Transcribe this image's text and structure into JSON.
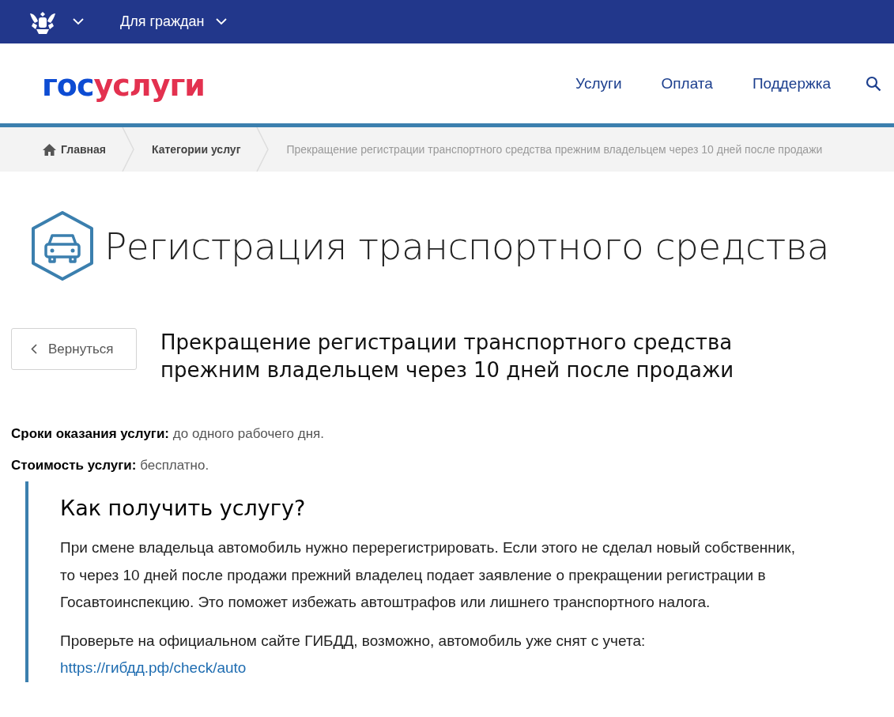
{
  "top_bar": {
    "audience_menu": "Для граждан"
  },
  "header": {
    "logo": [
      {
        "text": "гос",
        "color": "#0d4cd3"
      },
      {
        "text": "услуги",
        "color": "#e3314f"
      }
    ],
    "nav": [
      "Услуги",
      "Оплата",
      "Поддержка"
    ]
  },
  "breadcrumbs": [
    {
      "label": "Главная",
      "kind": "home"
    },
    {
      "label": "Категории услуг",
      "kind": "link"
    },
    {
      "label": "Прекращение регистрации транспортного средства прежним владельцем через 10 дней после продажи",
      "kind": "current"
    }
  ],
  "category_title": "Регистрация транспортного средства",
  "back_button": "Вернуться",
  "service_title": "Прекращение регистрации транспортного средства прежним владельцем через 10 дней после продажи",
  "facts": [
    {
      "label": "Сроки оказания услуги:",
      "value": "до одного рабочего дня."
    },
    {
      "label": "Стоимость услуги:",
      "value": "бесплатно."
    }
  ],
  "how_to": {
    "heading": "Как получить услугу?",
    "paragraphs": [
      {
        "text": "При смене владельца автомобиль нужно перерегистрировать. Если этого не сделал новый собственник, то через 10 дней после продажи прежний владелец подает заявление о прекращении регистрации в Госавтоинспекцию. Это поможет избежать автоштрафов или лишнего транспортного налога."
      },
      {
        "text": "Проверьте на официальном сайте ГИБДД, возможно, автомобиль уже снят с учета:",
        "link": "https://гибдд.рф/check/auto"
      }
    ]
  }
}
